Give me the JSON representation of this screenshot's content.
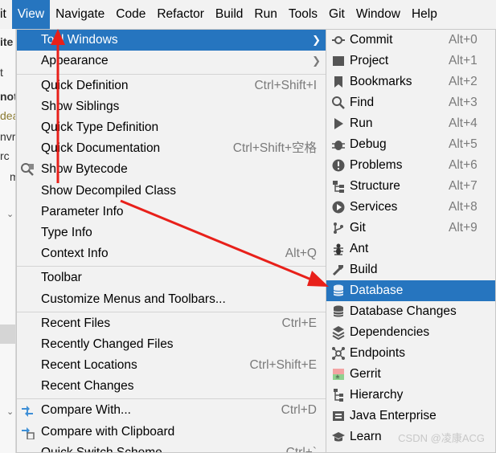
{
  "menubar": {
    "items": [
      "it",
      "View",
      "Navigate",
      "Code",
      "Refactor",
      "Build",
      "Run",
      "Tools",
      "Git",
      "Window",
      "Help"
    ],
    "active": "View"
  },
  "background": {
    "fragments": [
      "ite",
      "t",
      "not",
      "dea",
      "nvr",
      "rc",
      "m"
    ]
  },
  "view_menu": {
    "items": [
      {
        "label": "Tool Windows",
        "shortcut": "",
        "submenu": true,
        "selected": true
      },
      {
        "label": "Appearance",
        "shortcut": "",
        "submenu": true
      },
      {
        "label": "Quick Definition",
        "shortcut": "Ctrl+Shift+I"
      },
      {
        "label": "Show Siblings",
        "shortcut": ""
      },
      {
        "label": "Quick Type Definition",
        "shortcut": ""
      },
      {
        "label": "Quick Documentation",
        "shortcut": "Ctrl+Shift+空格"
      },
      {
        "label": "Show Bytecode",
        "shortcut": "",
        "icon": "bytecode-icon"
      },
      {
        "label": "Show Decompiled Class",
        "shortcut": ""
      },
      {
        "label": "Parameter Info",
        "shortcut": ""
      },
      {
        "label": "Type Info",
        "shortcut": ""
      },
      {
        "label": "Context Info",
        "shortcut": "Alt+Q"
      },
      {
        "label": "Toolbar",
        "shortcut": ""
      },
      {
        "label": "Customize Menus and Toolbars...",
        "shortcut": ""
      },
      {
        "label": "Recent Files",
        "shortcut": "Ctrl+E"
      },
      {
        "label": "Recently Changed Files",
        "shortcut": ""
      },
      {
        "label": "Recent Locations",
        "shortcut": "Ctrl+Shift+E"
      },
      {
        "label": "Recent Changes",
        "shortcut": ""
      },
      {
        "label": "Compare With...",
        "shortcut": "Ctrl+D",
        "icon": "compare-icon"
      },
      {
        "label": "Compare with Clipboard",
        "shortcut": "",
        "icon": "compare-clipboard-icon"
      },
      {
        "label": "Quick Switch Scheme...",
        "shortcut": "Ctrl+`"
      }
    ]
  },
  "tool_windows_menu": {
    "items": [
      {
        "label": "Commit",
        "shortcut": "Alt+0",
        "icon": "commit-icon"
      },
      {
        "label": "Project",
        "shortcut": "Alt+1",
        "icon": "project-icon"
      },
      {
        "label": "Bookmarks",
        "shortcut": "Alt+2",
        "icon": "bookmarks-icon"
      },
      {
        "label": "Find",
        "shortcut": "Alt+3",
        "icon": "find-icon"
      },
      {
        "label": "Run",
        "shortcut": "Alt+4",
        "icon": "run-icon"
      },
      {
        "label": "Debug",
        "shortcut": "Alt+5",
        "icon": "debug-icon"
      },
      {
        "label": "Problems",
        "shortcut": "Alt+6",
        "icon": "problems-icon"
      },
      {
        "label": "Structure",
        "shortcut": "Alt+7",
        "icon": "structure-icon"
      },
      {
        "label": "Services",
        "shortcut": "Alt+8",
        "icon": "services-icon"
      },
      {
        "label": "Git",
        "shortcut": "Alt+9",
        "icon": "git-icon"
      },
      {
        "label": "Ant",
        "shortcut": "",
        "icon": "ant-icon"
      },
      {
        "label": "Build",
        "shortcut": "",
        "icon": "build-icon"
      },
      {
        "label": "Database",
        "shortcut": "",
        "icon": "database-icon",
        "selected": true
      },
      {
        "label": "Database Changes",
        "shortcut": "",
        "icon": "database-changes-icon"
      },
      {
        "label": "Dependencies",
        "shortcut": "",
        "icon": "dependencies-icon"
      },
      {
        "label": "Endpoints",
        "shortcut": "",
        "icon": "endpoints-icon"
      },
      {
        "label": "Gerrit",
        "shortcut": "",
        "icon": "gerrit-icon"
      },
      {
        "label": "Hierarchy",
        "shortcut": "",
        "icon": "hierarchy-icon"
      },
      {
        "label": "Java Enterprise",
        "shortcut": "",
        "icon": "java-enterprise-icon"
      },
      {
        "label": "Learn",
        "shortcut": "",
        "icon": "learn-icon"
      }
    ]
  },
  "watermark": "CSDN @凌康ACG",
  "colors": {
    "selection": "#2675bf",
    "menu_bg": "#f2f2f2",
    "shortcut_text": "#7a7a7a",
    "annotation_arrow": "#e8201a"
  }
}
